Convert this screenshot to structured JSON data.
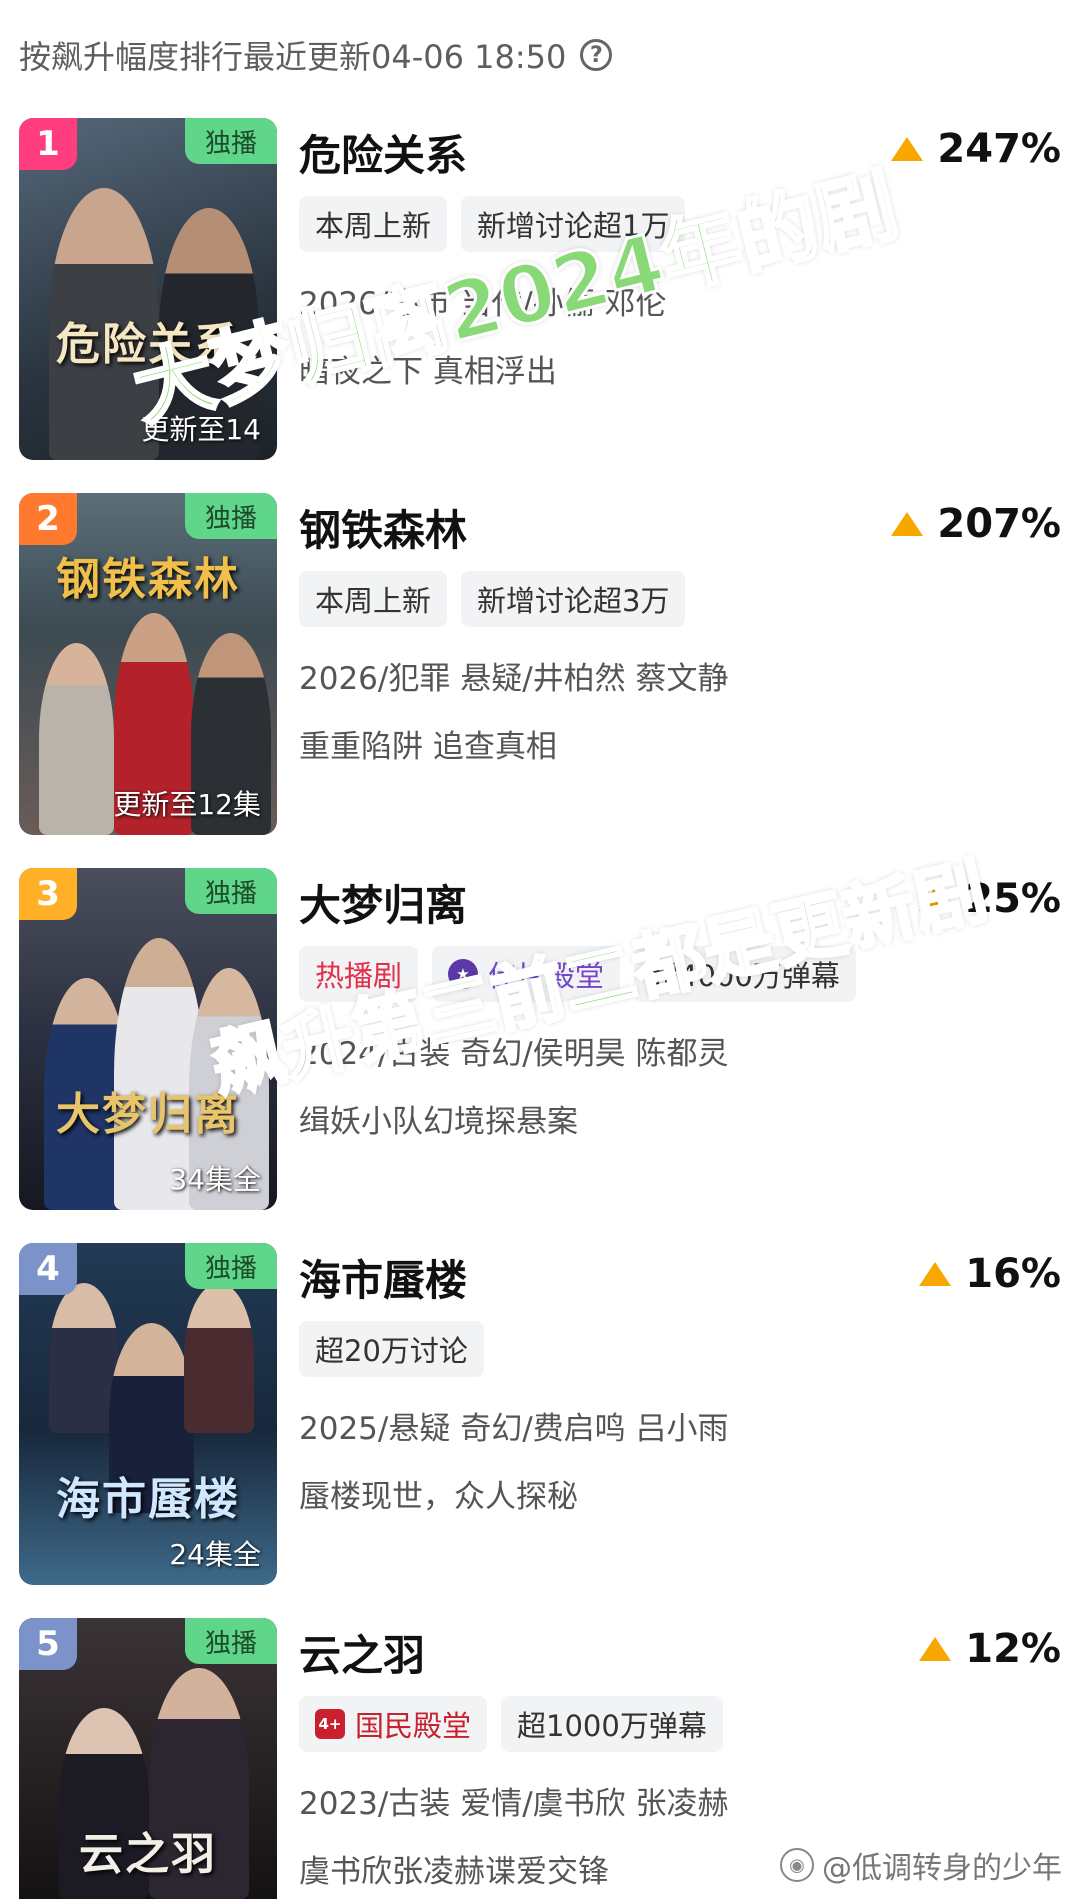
{
  "header": {
    "text": "按飙升幅度排行最近更新04-06 18:50",
    "help_icon": "?"
  },
  "items": [
    {
      "rank": "1",
      "rank_color": "#ff3d7f",
      "exclusive": "独播",
      "poster_title": "危险关系",
      "episodes": "更新至14",
      "title": "危险关系",
      "rise": "247%",
      "tags": [
        "本周上新",
        "新增讨论超1万"
      ],
      "meta": "2026/都市 当代/孙俪 邓伦",
      "desc": "暗夜之下 真相浮出",
      "poster_bg": "#3a4a55"
    },
    {
      "rank": "2",
      "rank_color": "#ff7a2e",
      "exclusive": "独播",
      "poster_title": "钢铁森林",
      "episodes": "更新至12集",
      "title": "钢铁森林",
      "rise": "207%",
      "tags": [
        "本周上新",
        "新增讨论超3万"
      ],
      "meta": "2026/犯罪 悬疑/井柏然 蔡文静",
      "desc": "重重陷阱 追查真相",
      "poster_bg": "#55606a"
    },
    {
      "rank": "3",
      "rank_color": "#ffb026",
      "exclusive": "独播",
      "poster_title": "大梦归离",
      "episodes": "34集全",
      "title": "大梦归离",
      "rise": "25%",
      "tags": [
        "热播剧",
        "佳片殿堂",
        "超4000万弹幕"
      ],
      "meta": "2024/古装 奇幻/侯明昊 陈都灵",
      "desc": "缉妖小队幻境探悬案",
      "poster_bg": "#2b3040"
    },
    {
      "rank": "4",
      "rank_color": "#7b93c9",
      "exclusive": "独播",
      "poster_title": "海市蜃楼",
      "episodes": "24集全",
      "title": "海市蜃楼",
      "rise": "16%",
      "tags": [
        "超20万讨论"
      ],
      "meta": "2025/悬疑 奇幻/费启鸣 吕小雨",
      "desc": "蜃楼现世，众人探秘",
      "poster_bg": "#1e3550"
    },
    {
      "rank": "5",
      "rank_color": "#7b93c9",
      "exclusive": "独播",
      "poster_title": "云之羽",
      "episodes": "",
      "title": "云之羽",
      "rise": "12%",
      "tags": [
        "国民殿堂",
        "超1000万弹幕"
      ],
      "meta": "2023/古装 爱情/虞书欣 张凌赫",
      "desc": "虞书欣张凌赫谍爱交锋",
      "poster_bg": "#2e2a2c"
    }
  ],
  "overlay": {
    "line1": "大梦归离2024年的剧",
    "line2": "飙升第三前二都是更新剧"
  },
  "watermark": "@低调转身的少年"
}
